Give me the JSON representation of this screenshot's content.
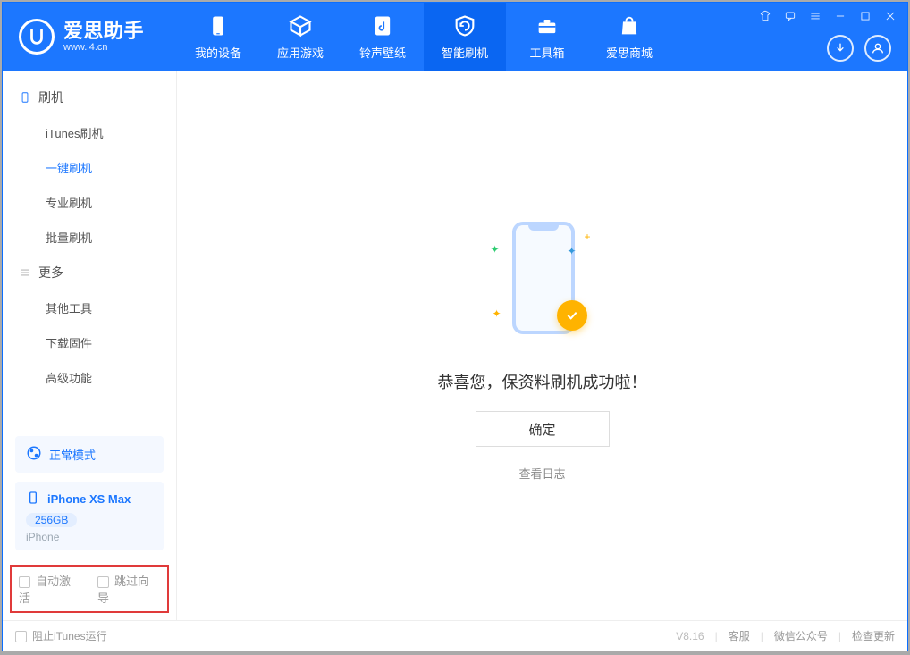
{
  "brand": {
    "title": "爱思助手",
    "sub": "www.i4.cn"
  },
  "tabs": [
    {
      "key": "device",
      "label": "我的设备"
    },
    {
      "key": "apps",
      "label": "应用游戏"
    },
    {
      "key": "ring",
      "label": "铃声壁纸"
    },
    {
      "key": "flash",
      "label": "智能刷机",
      "active": true
    },
    {
      "key": "tools",
      "label": "工具箱"
    },
    {
      "key": "store",
      "label": "爱思商城"
    }
  ],
  "sidebar": {
    "group1_title": "刷机",
    "group1_items": [
      {
        "label": "iTunes刷机"
      },
      {
        "label": "一键刷机",
        "active": true
      },
      {
        "label": "专业刷机"
      },
      {
        "label": "批量刷机"
      }
    ],
    "group2_title": "更多",
    "group2_items": [
      {
        "label": "其他工具"
      },
      {
        "label": "下载固件"
      },
      {
        "label": "高级功能"
      }
    ],
    "mode_label": "正常模式",
    "device_name": "iPhone XS Max",
    "device_storage": "256GB",
    "device_type": "iPhone",
    "opt_auto_activate": "自动激活",
    "opt_skip_guide": "跳过向导"
  },
  "main": {
    "success": "恭喜您，保资料刷机成功啦！",
    "ok": "确定",
    "view_log": "查看日志"
  },
  "statusbar": {
    "block_itunes": "阻止iTunes运行",
    "version": "V8.16",
    "support": "客服",
    "wechat": "微信公众号",
    "check_update": "检查更新"
  }
}
